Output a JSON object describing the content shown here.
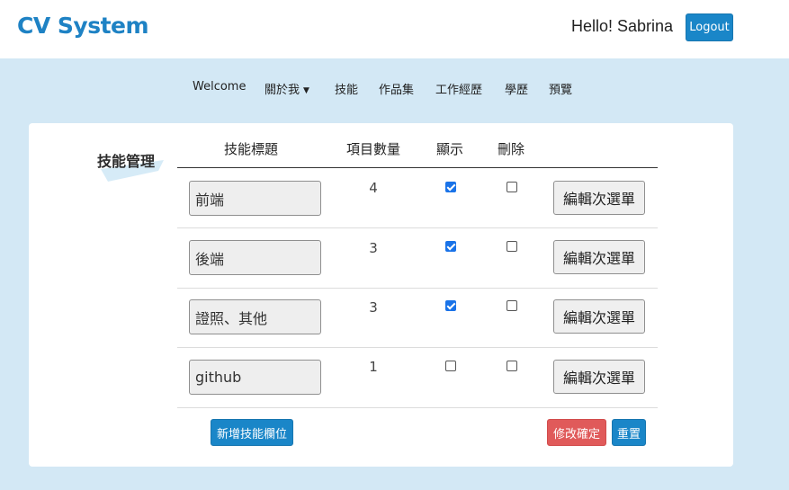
{
  "header": {
    "brand": "CV System",
    "greeting": "Hello! Sabrina",
    "logout_label": "Logout"
  },
  "nav": {
    "items": [
      {
        "label": "Welcome"
      },
      {
        "label": "關於我",
        "has_dropdown": true
      },
      {
        "label": "技能"
      },
      {
        "label": "作品集"
      },
      {
        "label": "工作經歷"
      },
      {
        "label": "學歷"
      },
      {
        "label": "預覽"
      }
    ]
  },
  "section": {
    "title": "技能管理"
  },
  "table": {
    "headers": [
      "技能標題",
      "項目數量",
      "顯示",
      "刪除"
    ],
    "rows": [
      {
        "title": "前端",
        "count": "4",
        "show": true,
        "delete": false,
        "submenu_label": "編輯次選單"
      },
      {
        "title": "後端",
        "count": "3",
        "show": true,
        "delete": false,
        "submenu_label": "編輯次選單"
      },
      {
        "title": "證照、其他",
        "count": "3",
        "show": true,
        "delete": false,
        "submenu_label": "編輯次選單"
      },
      {
        "title": "github",
        "count": "1",
        "show": false,
        "delete": false,
        "submenu_label": "編輯次選單"
      }
    ]
  },
  "actions": {
    "add_label": "新增技能欄位",
    "confirm_label": "修改確定",
    "reset_label": "重置"
  },
  "colors": {
    "brand": "#1e82c4",
    "page_bg": "#d3e8f5",
    "primary_button": "#1a86c8",
    "danger_button": "#e05a5a",
    "checkbox_checked": "#1a73e8"
  }
}
